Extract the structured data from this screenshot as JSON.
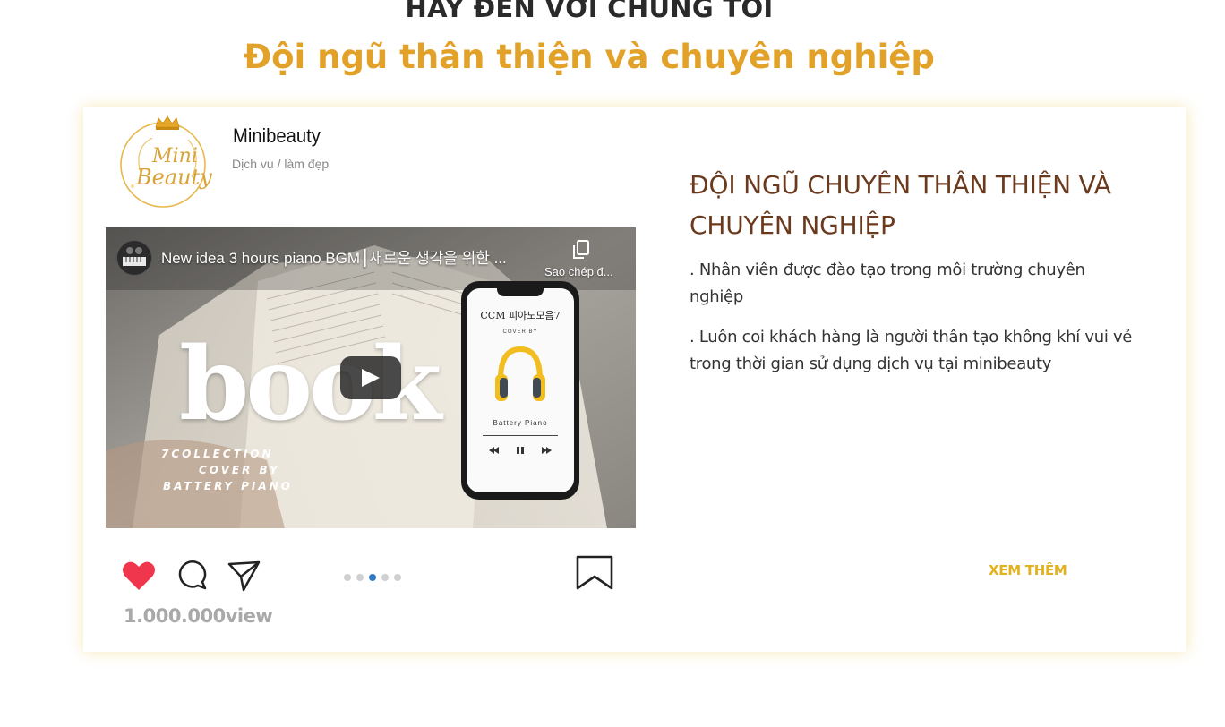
{
  "section": {
    "kicker": "HÃY ĐẾN VỚI CHÚNG TÔI",
    "headline": "Đội ngũ thân thiện và chuyên nghiệp"
  },
  "post": {
    "brand_name": "Minibeauty",
    "brand_category": "Dịch vụ / làm đẹp",
    "logo_text_line1": "Mini",
    "logo_text_line2": "Beauty",
    "video": {
      "title": "New idea 3 hours piano BGM┃새로운 생각을 위한 ...",
      "copy_label": "Sao chép đ...",
      "thumb_word": "book",
      "thumb_lines": [
        "7COLLECTION",
        "COVER BY",
        "BATTERY PIANO"
      ],
      "phone_title": "CCM 피아노모음7",
      "phone_coverby": "COVER BY",
      "phone_artist": "Battery Piano"
    },
    "views": "1.000.000view",
    "carousel_active_index": 2,
    "carousel_count": 5
  },
  "info": {
    "title": "ĐỘI NGŨ CHUYÊN THÂN THIỆN VÀ CHUYÊN NGHIỆP",
    "paragraph1": ". Nhân viên được đào tạo trong môi trường chuyên nghiệp",
    "paragraph2": ". Luôn coi khách hàng là người thân tạo không khí vui vẻ trong thời gian sử dụng dịch vụ tại minibeauty",
    "see_more": "XEM THÊM"
  },
  "colors": {
    "headline": "#e2a22a",
    "info_title": "#6b3a1c",
    "see_more": "#e2b21e",
    "heart": "#f0364c",
    "card_shadow": "#ebcd5a"
  }
}
